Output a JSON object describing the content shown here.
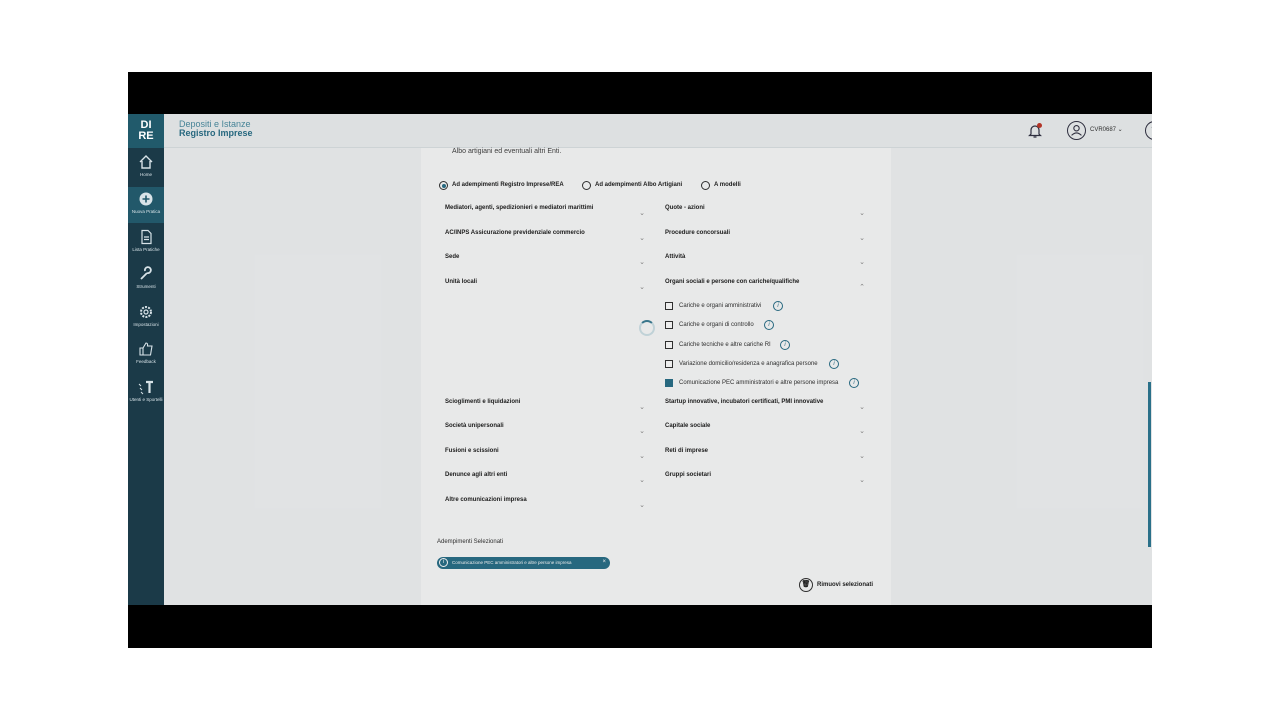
{
  "sidebar": {
    "logo_top": "DI",
    "logo_bottom": "RE",
    "items": [
      {
        "label": "Home",
        "icon": "home-icon"
      },
      {
        "label": "Nuova Pratica",
        "icon": "plus-circle-icon"
      },
      {
        "label": "Lista Pratiche",
        "icon": "document-icon"
      },
      {
        "label": "Strumenti",
        "icon": "wrench-icon"
      },
      {
        "label": "Impostazioni",
        "icon": "gear-icon"
      },
      {
        "label": "Feedback",
        "icon": "thumbs-up-icon"
      },
      {
        "label": "Utenti e Sportelli",
        "icon": "text-size-icon"
      }
    ]
  },
  "header": {
    "subtitle": "Depositi e Istanze",
    "title": "Registro Imprese",
    "user": "CVR0687 ⌄",
    "help": "?"
  },
  "content": {
    "intro": "Albo artigiani ed eventuali altri Enti.",
    "radios": [
      {
        "label": "Ad adempimenti Registro Imprese/REA",
        "selected": true
      },
      {
        "label": "Ad adempimenti Albo Artigiani",
        "selected": false
      },
      {
        "label": "A modelli",
        "selected": false
      }
    ],
    "left_sections": [
      "Mediatori, agenti, spedizionieri e mediatori marittimi",
      "AC/INPS Assicurazione previdenziale commercio",
      "Sede",
      "Unità locali",
      "Scioglimenti e liquidazioni",
      "Società unipersonali",
      "Fusioni e scissioni",
      "Denunce agli altri enti",
      "Altre comunicazioni impresa"
    ],
    "right_sections": [
      "Quote - azioni",
      "Procedure concorsuali",
      "Attività",
      "Organi sociali e persone con cariche/qualifiche",
      "Startup innovative, incubatori certificati, PMI innovative",
      "Capitale sociale",
      "Reti di imprese",
      "Gruppi societari"
    ],
    "sub_options": [
      {
        "label": "Cariche e organi amministrativi",
        "checked": false
      },
      {
        "label": "Cariche e organi di controllo",
        "checked": false
      },
      {
        "label": "Cariche tecniche e altre cariche RI",
        "checked": false
      },
      {
        "label": "Variazione domicilio/residenza e anagrafica persone",
        "checked": false
      },
      {
        "label": "Comunicazione PEC amministratori e altre persone impresa",
        "checked": true
      }
    ],
    "selected_title": "Adempimenti Selezionati",
    "selected_chip": "Comunicazione PEC amministratori e altre persone impresa",
    "remove_label": "Rimuovi selezionati"
  },
  "colors": {
    "accent": "#2a7089",
    "sidebar": "#1b3a48"
  }
}
